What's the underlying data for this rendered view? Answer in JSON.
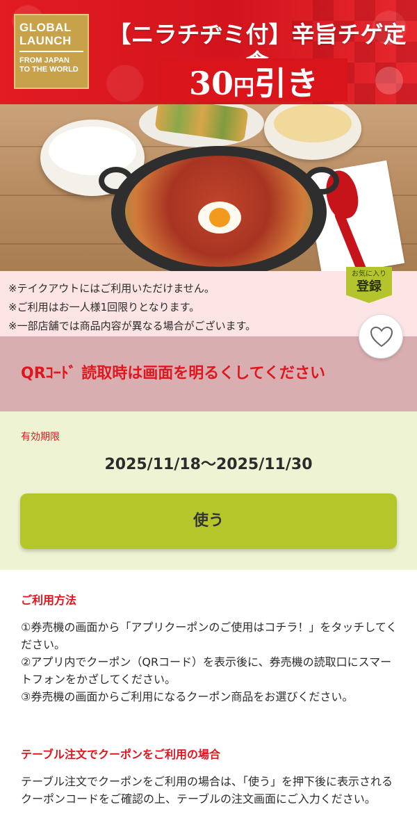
{
  "banner": {
    "logo_line1": "GLOBAL",
    "logo_line2": "LAUNCH",
    "logo_line3": "FROM JAPAN",
    "logo_line4": "TO THE WORLD",
    "title": "【ニラチヂミ付】辛旨チゲ定食",
    "discount_amount": "30",
    "discount_unit": "円",
    "discount_word": "引き"
  },
  "notices": [
    "※テイクアウトにはご利用いただけません。",
    "※ご利用はお一人様1回限りとなります。",
    "※一部店舗では商品内容が異なる場合がございます。"
  ],
  "favorite": {
    "small": "お気に入り",
    "big": "登録"
  },
  "qr_warning": "QRｺｰﾄﾞ 読取時は画面を明るくしてください",
  "validity": {
    "label": "有効期限",
    "dates": "2025/11/18～2025/11/30"
  },
  "use_button": "使う",
  "howto": {
    "heading": "ご利用方法",
    "step1": "①券売機の画面から「アプリクーポンのご使用はコチラ！」をタッチしてください。",
    "step2": "②アプリ内でクーポン（QRコード）を表示後に、券売機の読取口にスマートフォンをかざしてください。",
    "step3": "③券売機の画面からご利用になるクーポン商品をお選びください。"
  },
  "table_order": {
    "heading": "テーブル注文でクーポンをご利用の場合",
    "body": "テーブル注文でクーポンをご利用の場合は、「使う」を押下後に表示されるクーポンコードをご確認の上、テーブルの注文画面にご入力ください。"
  },
  "colors": {
    "brand_red": "#e0161f",
    "accent_green": "#b5c62a",
    "gold": "#c8a24a"
  },
  "icons": {
    "favorite": "heart-icon"
  }
}
